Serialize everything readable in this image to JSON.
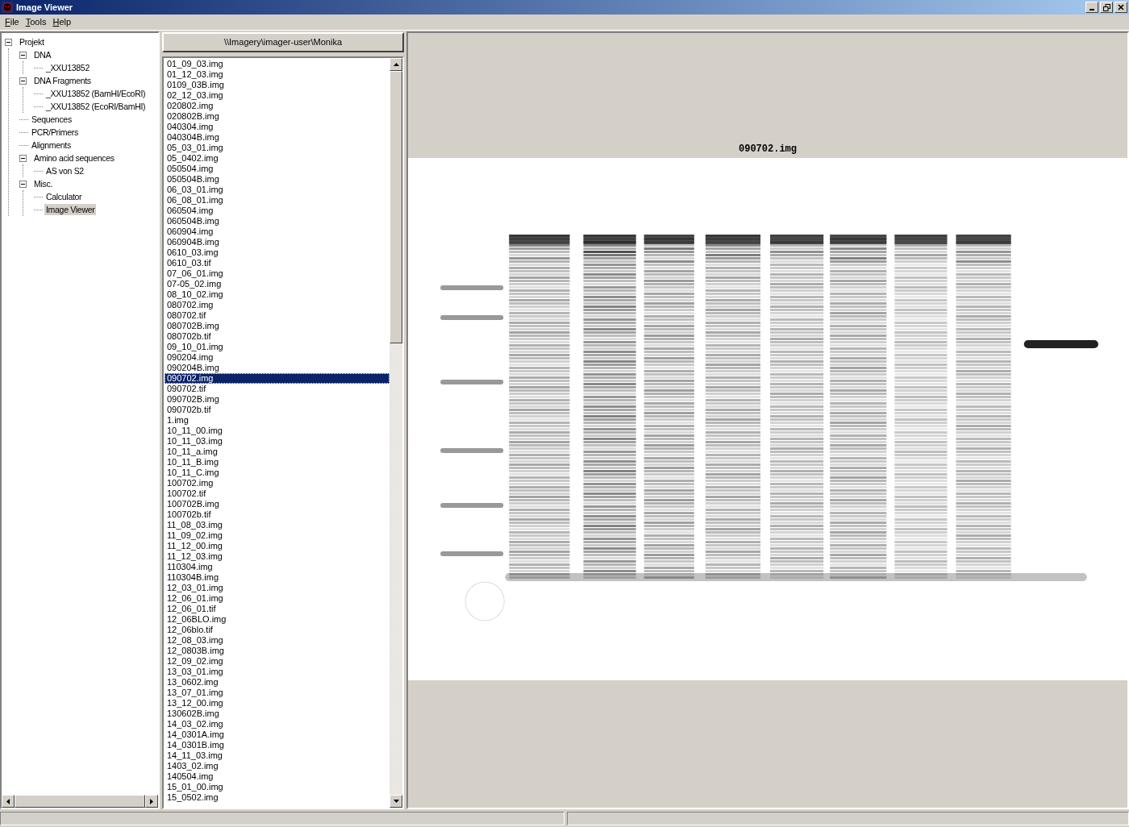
{
  "window": {
    "title": "Image Viewer"
  },
  "menu": [
    {
      "label": "File"
    },
    {
      "label": "Tools"
    },
    {
      "label": "Help"
    }
  ],
  "tree": [
    {
      "label": "Projekt",
      "expanded": true,
      "selected": false,
      "children": [
        {
          "label": "DNA",
          "expanded": true,
          "selected": false,
          "children": [
            {
              "label": "_XXU13852",
              "selected": false
            }
          ]
        },
        {
          "label": "DNA Fragments",
          "expanded": true,
          "selected": false,
          "children": [
            {
              "label": "_XXU13852 (BamHI/EcoRI)",
              "selected": false
            },
            {
              "label": "_XXU13852 (EcoRI/BamHI)",
              "selected": false
            }
          ]
        },
        {
          "label": "Sequences",
          "selected": false
        },
        {
          "label": "PCR/Primers",
          "selected": false
        },
        {
          "label": "Alignments",
          "selected": false
        },
        {
          "label": "Amino acid sequences",
          "expanded": true,
          "selected": false,
          "children": [
            {
              "label": "AS von S2",
              "selected": false
            }
          ]
        },
        {
          "label": "Misc.",
          "expanded": true,
          "selected": false,
          "children": [
            {
              "label": "Calculator",
              "selected": false
            },
            {
              "label": "Image Viewer",
              "selected": true
            }
          ]
        }
      ]
    }
  ],
  "path_header": "\\\\Imagery\\imager-user\\Monika",
  "files": [
    {
      "name": "01_09_03.img",
      "selected": false
    },
    {
      "name": "01_12_03.img",
      "selected": false
    },
    {
      "name": "0109_03B.img",
      "selected": false
    },
    {
      "name": "02_12_03.img",
      "selected": false
    },
    {
      "name": "020802.img",
      "selected": false
    },
    {
      "name": "020802B.img",
      "selected": false
    },
    {
      "name": "040304.img",
      "selected": false
    },
    {
      "name": "040304B.img",
      "selected": false
    },
    {
      "name": "05_03_01.img",
      "selected": false
    },
    {
      "name": "05_0402.img",
      "selected": false
    },
    {
      "name": "050504.img",
      "selected": false
    },
    {
      "name": "050504B.img",
      "selected": false
    },
    {
      "name": "06_03_01.img",
      "selected": false
    },
    {
      "name": "06_08_01.img",
      "selected": false
    },
    {
      "name": "060504.img",
      "selected": false
    },
    {
      "name": "060504B.img",
      "selected": false
    },
    {
      "name": "060904.img",
      "selected": false
    },
    {
      "name": "060904B.img",
      "selected": false
    },
    {
      "name": "0610_03.img",
      "selected": false
    },
    {
      "name": "0610_03.tif",
      "selected": false
    },
    {
      "name": "07_06_01.img",
      "selected": false
    },
    {
      "name": "07-05_02.img",
      "selected": false
    },
    {
      "name": "08_10_02.img",
      "selected": false
    },
    {
      "name": "080702.img",
      "selected": false
    },
    {
      "name": "080702.tif",
      "selected": false
    },
    {
      "name": "080702B.img",
      "selected": false
    },
    {
      "name": "080702b.tif",
      "selected": false
    },
    {
      "name": "09_10_01.img",
      "selected": false
    },
    {
      "name": "090204.img",
      "selected": false
    },
    {
      "name": "090204B.img",
      "selected": false
    },
    {
      "name": "090702.img",
      "selected": true
    },
    {
      "name": "090702.tif",
      "selected": false
    },
    {
      "name": "090702B.img",
      "selected": false
    },
    {
      "name": "090702b.tif",
      "selected": false
    },
    {
      "name": "1.img",
      "selected": false
    },
    {
      "name": "10_11_00.img",
      "selected": false
    },
    {
      "name": "10_11_03.img",
      "selected": false
    },
    {
      "name": "10_11_a.img",
      "selected": false
    },
    {
      "name": "10_11_B.img",
      "selected": false
    },
    {
      "name": "10_11_C.img",
      "selected": false
    },
    {
      "name": "100702.img",
      "selected": false
    },
    {
      "name": "100702.tif",
      "selected": false
    },
    {
      "name": "100702B.img",
      "selected": false
    },
    {
      "name": "100702b.tif",
      "selected": false
    },
    {
      "name": "11_08_03.img",
      "selected": false
    },
    {
      "name": "11_09_02.img",
      "selected": false
    },
    {
      "name": "11_12_00.img",
      "selected": false
    },
    {
      "name": "11_12_03.img",
      "selected": false
    },
    {
      "name": "110304.img",
      "selected": false
    },
    {
      "name": "110304B.img",
      "selected": false
    },
    {
      "name": "12_03_01.img",
      "selected": false
    },
    {
      "name": "12_06_01.img",
      "selected": false
    },
    {
      "name": "12_06_01.tif",
      "selected": false
    },
    {
      "name": "12_06BLO.img",
      "selected": false
    },
    {
      "name": "12_06blo.tif",
      "selected": false
    },
    {
      "name": "12_08_03.img",
      "selected": false
    },
    {
      "name": "12_0803B.img",
      "selected": false
    },
    {
      "name": "12_09_02.img",
      "selected": false
    },
    {
      "name": "13_03_01.img",
      "selected": false
    },
    {
      "name": "13_0602.img",
      "selected": false
    },
    {
      "name": "13_07_01.img",
      "selected": false
    },
    {
      "name": "13_12_00.img",
      "selected": false
    },
    {
      "name": "130602B.img",
      "selected": false
    },
    {
      "name": "14_03_02.img",
      "selected": false
    },
    {
      "name": "14_0301A.img",
      "selected": false
    },
    {
      "name": "14_0301B.img",
      "selected": false
    },
    {
      "name": "14_11_03.img",
      "selected": false
    },
    {
      "name": "1403_02.img",
      "selected": false
    },
    {
      "name": "140504.img",
      "selected": false
    },
    {
      "name": "15_01_00.img",
      "selected": false
    },
    {
      "name": "15_0502.img",
      "selected": false
    }
  ],
  "viewer": {
    "image_title": "090702.img"
  }
}
